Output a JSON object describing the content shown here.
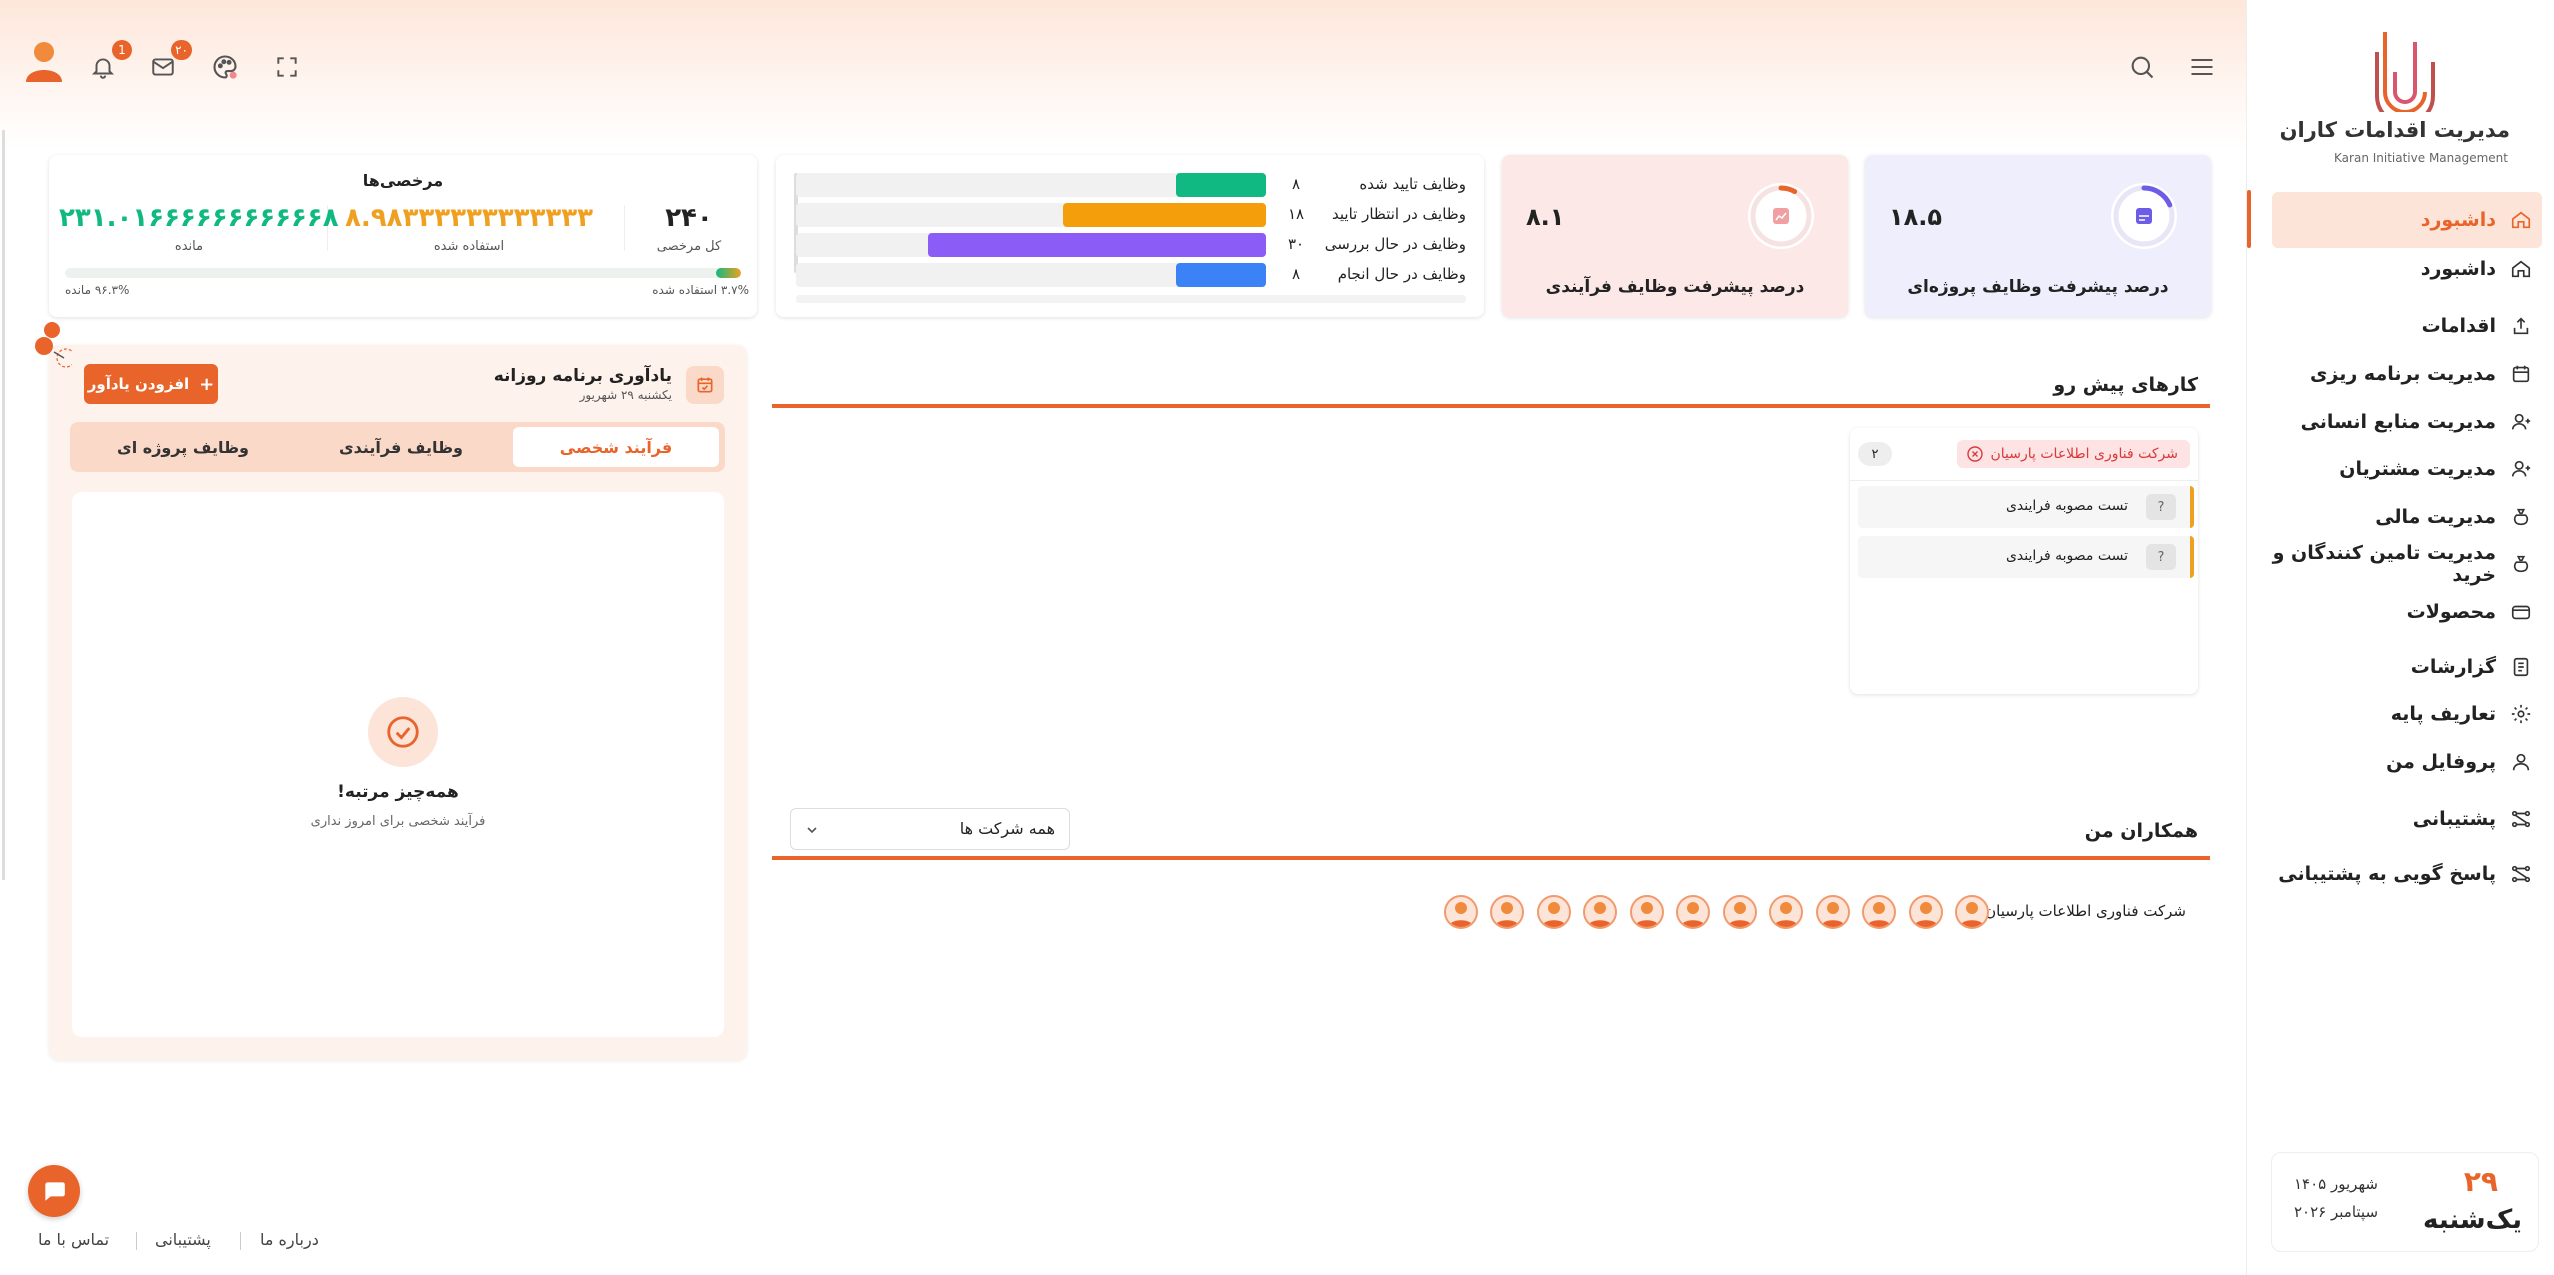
{
  "brand": {
    "title": "مدیریت اقدامات کاران",
    "subtitle": "Karan Initiative Management",
    "accent": "#e8642a"
  },
  "header": {
    "notification_count": "1",
    "message_count": "۲۰",
    "icons": [
      "user-avatar-icon",
      "bell-icon",
      "mail-icon",
      "palette-icon",
      "fullscreen-icon",
      "search-icon",
      "menu-icon"
    ]
  },
  "sidebar": {
    "items": [
      {
        "label": "داشبورد",
        "icon": "home-icon",
        "active": true
      },
      {
        "label": "داشبورد",
        "icon": "home-icon"
      },
      {
        "label": "اقدامات",
        "icon": "upload-icon"
      },
      {
        "label": "مدیریت برنامه ریزی",
        "icon": "calendar-icon"
      },
      {
        "label": "مدیریت منابع انسانی",
        "icon": "user-icon"
      },
      {
        "label": "مدیریت مشتریان",
        "icon": "user-icon"
      },
      {
        "label": "مدیریت مالی",
        "icon": "money-bag-icon"
      },
      {
        "label": "مدیریت تامین کنندگان و خرید",
        "icon": "money-bag-icon"
      },
      {
        "label": "محصولات",
        "icon": "wallet-icon"
      },
      {
        "label": "گزارشات",
        "icon": "report-icon"
      },
      {
        "label": "تعاریف پایه",
        "icon": "gear-icon"
      },
      {
        "label": "پروفایل من",
        "icon": "profile-icon"
      },
      {
        "label": "پشتیبانی",
        "icon": "support-icon"
      },
      {
        "label": "پاسخ گویی به پشتیبانی",
        "icon": "support-icon"
      }
    ],
    "date": {
      "day_num": "۲۹",
      "weekday": "یک‌شنبه",
      "persian_month_year": "شهریور ۱۴۰۵",
      "gregorian_month_year": "سپتامبر ۲۰۲۶"
    }
  },
  "stats": {
    "project_progress": {
      "label": "درصد پیشرفت وظایف پروژه‌ای",
      "value": "۱۸.۵",
      "fraction": 0.185,
      "color": "#6c5ce7"
    },
    "process_progress": {
      "label": "درصد پیشرفت وظایف فرآیندی",
      "value": "۸.۱",
      "fraction": 0.081,
      "color": "#e8642a"
    }
  },
  "task_status": [
    {
      "label": "وظایف تایید شده",
      "count": "۸",
      "value": 8,
      "color": "#10b981"
    },
    {
      "label": "وظایف در انتظار تایید",
      "count": "۱۸",
      "value": 18,
      "color": "#f59e0b"
    },
    {
      "label": "وظایف در حال بررسی",
      "count": "۳۰",
      "value": 30,
      "color": "#8b5cf6"
    },
    {
      "label": "وظایف در حال انجام",
      "count": "۸",
      "value": 8,
      "color": "#3b82f6"
    }
  ],
  "leave": {
    "title": "مرخصی‌ها",
    "total_value": "۲۴۰",
    "total_label": "کل مرخصی",
    "used_value": "۸.۹۸۳۳۳۳۳۳۳۳۳۳۳۳",
    "used_label": "استفاده شده",
    "remaining_value": "۲۳۱.۰۱۶۶۶۶۶۶۶۶۶۶۶۸",
    "remaining_label": "مانده",
    "used_percent_text": "۳.۷% استفاده شده",
    "remaining_percent_text": "۹۶.۳% مانده",
    "used_fraction": 0.037
  },
  "reminders": {
    "title": "یادآوری برنامه روزانه",
    "date": "یکشنبه ۲۹ شهریور",
    "add_button": "افزودن یادآور",
    "tabs": [
      "فرآیند شخصی",
      "وظایف فرآیندی",
      "وظایف پروژه ای"
    ],
    "active_tab": 0,
    "empty_title": "همه‌چیز مرتبه!",
    "empty_text": "فرآیند شخصی برای امروز نداری"
  },
  "upcoming": {
    "title": "کارهای پیش رو",
    "company": "شرکت فناوری اطلاعات پارسیان",
    "count": "۲",
    "tasks": [
      "تست مصوبه فرایندی",
      "تست مصوبه فرایندی"
    ],
    "q_mark": "?"
  },
  "colleagues": {
    "title": "همکاران من",
    "filter_value": "همه شرکت ها",
    "company": "شرکت فناوری اطلاعات پارسیان",
    "avatar_count": 12
  },
  "footer": {
    "links": [
      "درباره ما",
      "پشتیبانی",
      "تماس با ما"
    ]
  }
}
